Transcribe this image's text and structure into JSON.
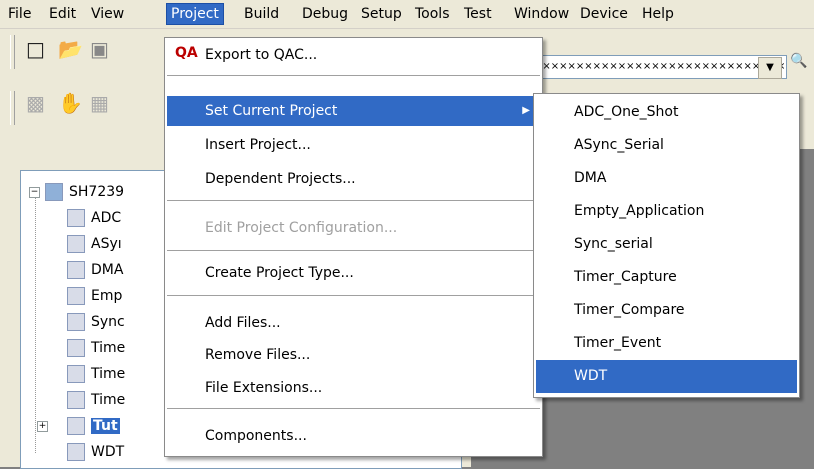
{
  "menubar": [
    "File",
    "Edit",
    "View",
    "Project",
    "Build",
    "Debug",
    "Setup",
    "Tools",
    "Test",
    "Window",
    "Device",
    "Help"
  ],
  "toolbar": {
    "combo_value": "××××××××××××××××××××××××××××××"
  },
  "tree": {
    "root": "SH7239",
    "items": [
      "ADC",
      "ASyı",
      "DMA",
      "Emp",
      "Sync",
      "Time",
      "Time",
      "Time",
      "Tut",
      "WDT"
    ]
  },
  "project_menu": {
    "export_qac": "Export to QAC...",
    "set_current_project": "Set Current Project",
    "insert_project": "Insert Project...",
    "dependent_projects": "Dependent Projects...",
    "edit_project_configuration": "Edit Project Configuration...",
    "create_project_type": "Create Project Type...",
    "add_files": "Add Files...",
    "remove_files": "Remove Files...",
    "file_extensions": "File Extensions...",
    "components": "Components..."
  },
  "submenu": [
    "ADC_One_Shot",
    "ASync_Serial",
    "DMA",
    "Empty_Application",
    "Sync_serial",
    "Timer_Capture",
    "Timer_Compare",
    "Timer_Event",
    "WDT"
  ],
  "colors": {
    "highlight": "#316ac5",
    "menubar": "#ece9d8"
  }
}
